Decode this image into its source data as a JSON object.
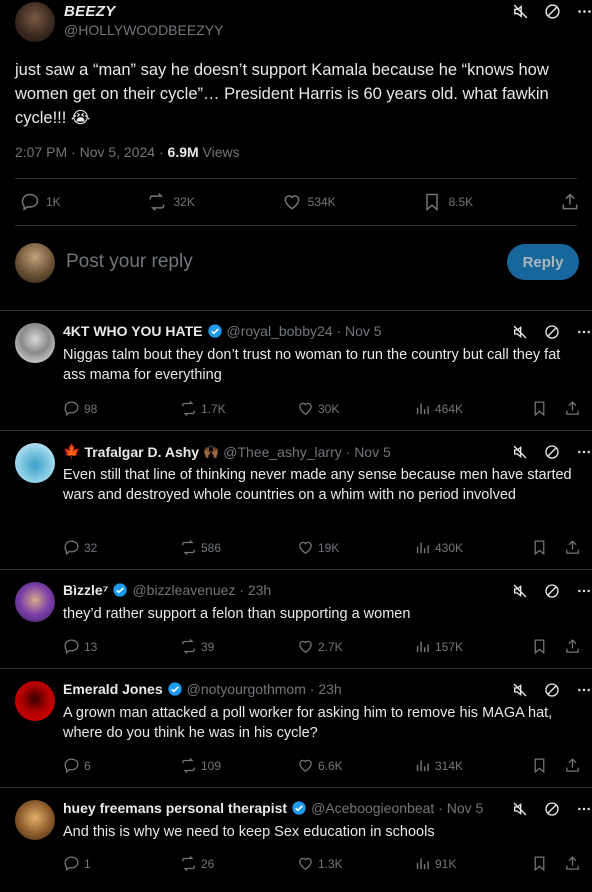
{
  "post": {
    "author_name": "BEEZY",
    "author_handle": "@HOLLYWOODBEEZYY",
    "text": "just saw a “man” say he doesn’t support Kamala because he “knows how women get on their cycle”… President Harris is 60 years old. what fawkin cycle!!! 😭",
    "time": "2:07 PM · Nov 5, 2024 · ",
    "views_count": "6.9M",
    "views_label": " Views",
    "replies": "1K",
    "reposts": "32K",
    "likes": "534K",
    "bookmarks": "8.5K"
  },
  "compose": {
    "placeholder": "Post your reply",
    "reply_button": "Reply"
  },
  "replies": [
    {
      "name": "4KT WHO YOU HATE",
      "handle": "@royal_bobby24 · Nov 5",
      "text": "Niggas talm bout they don’t trust no woman to run the country but call they fat ass mama for everything",
      "replies": "98",
      "reposts": "1.7K",
      "likes": "30K",
      "views": "464K"
    },
    {
      "name": "Trafalgar D. Ashy",
      "handle": "@Thee_ashy_larry · Nov 5",
      "text": "Even still that line of thinking never made any sense because men have started wars and destroyed whole countries on a whim with no period involved",
      "replies": "32",
      "reposts": "586",
      "likes": "19K",
      "views": "430K"
    },
    {
      "name": "Bìzzle⁷",
      "handle": "@bizzleavenuez · 23h",
      "text": "they’d rather support a felon than supporting a women",
      "replies": "13",
      "reposts": "39",
      "likes": "2.7K",
      "views": "157K"
    },
    {
      "name": "Emerald Jones",
      "handle": "@notyourgothmom · 23h",
      "text": "A grown man attacked a poll worker for asking him to remove his MAGA hat, where do you think he was in his cycle?",
      "replies": "6",
      "reposts": "109",
      "likes": "6.6K",
      "views": "314K"
    },
    {
      "name": "huey freemans personal therapist",
      "handle": "@Aceboogieonbeat · Nov 5",
      "text": "And this is why we need to keep Sex education in schools",
      "replies": "1",
      "reposts": "26",
      "likes": "1.3K",
      "views": "91K"
    }
  ],
  "colors": {
    "accent": "#1d9bf0",
    "muted": "#71767b",
    "divider": "#2f3336"
  }
}
